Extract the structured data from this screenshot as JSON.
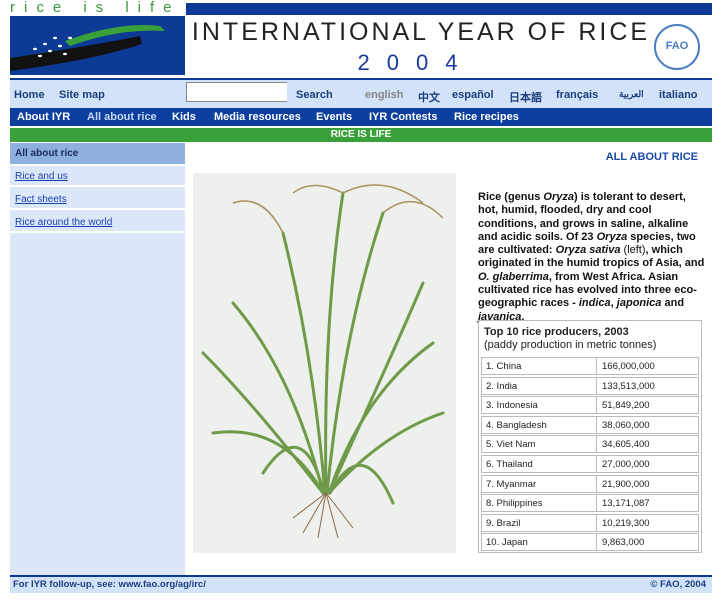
{
  "logo": {
    "tagline": "rice is life"
  },
  "header": {
    "title": "INTERNATIONAL YEAR OF RICE",
    "year": "2004",
    "fao_logo": "FAO"
  },
  "nav_top": {
    "home": "Home",
    "site_map": "Site map",
    "search_placeholder": "",
    "search": "Search",
    "languages": [
      "english",
      "中文",
      "español",
      "日本語",
      "français",
      "العربية",
      "italiano"
    ]
  },
  "nav_main": [
    "About IYR",
    "All about rice",
    "Kids",
    "Media resources",
    "Events",
    "IYR Contests",
    "Rice recipes"
  ],
  "banner": "RICE IS LIFE",
  "sidebar": {
    "header": "All about rice",
    "items": [
      "Rice and us",
      "Fact sheets",
      "Rice around the world"
    ]
  },
  "main": {
    "section_title": "ALL ABOUT RICE",
    "paragraph": [
      {
        "t": "Rice (genus "
      },
      {
        "t": "Oryza",
        "i": true
      },
      {
        "t": ") is tolerant to desert, hot, humid, flooded, dry and cool conditions, and grows in saline, alkaline and acidic soils. Of 23 "
      },
      {
        "t": "Oryza",
        "i": true
      },
      {
        "t": " species, two are cultivated: "
      },
      {
        "t": "Oryza sativa",
        "i": true
      },
      {
        "t": " (left)",
        "l": true
      },
      {
        "t": ", which originated in the humid tropics of Asia, and "
      },
      {
        "t": "O. glaberrima",
        "i": true
      },
      {
        "t": ", from West Africa. Asian cultivated rice has evolved into three eco-geographic races - "
      },
      {
        "t": "indica",
        "i": true
      },
      {
        "t": ", "
      },
      {
        "t": "japonica",
        "i": true
      },
      {
        "t": " and "
      },
      {
        "t": "javanica",
        "i": true
      },
      {
        "t": "."
      }
    ],
    "table": {
      "title": "Top 10 rice producers, 2003",
      "subtitle": "(paddy production in metric tonnes)",
      "rows": [
        [
          "1. China",
          "166,000,000"
        ],
        [
          "2. India",
          "133,513,000"
        ],
        [
          "3. Indonesia",
          "51,849,200"
        ],
        [
          "4. Bangladesh",
          "38,060,000"
        ],
        [
          "5. Viet Nam",
          "34,605,400"
        ],
        [
          "6. Thailand",
          "27,000,000"
        ],
        [
          "7. Myanmar",
          "21,900,000"
        ],
        [
          "8. Philippines",
          "13,171,087"
        ],
        [
          "9. Brazil",
          "10,219,300"
        ],
        [
          "10. Japan",
          "9,863,000"
        ]
      ]
    }
  },
  "footer": {
    "left": "For IYR follow-up, see: www.fao.org/ag/irc/",
    "right": "© FAO, 2004"
  },
  "colors": {
    "brand_blue": "#0d3a94",
    "green": "#3aa13a",
    "light_blue": "#d2e2f8"
  }
}
